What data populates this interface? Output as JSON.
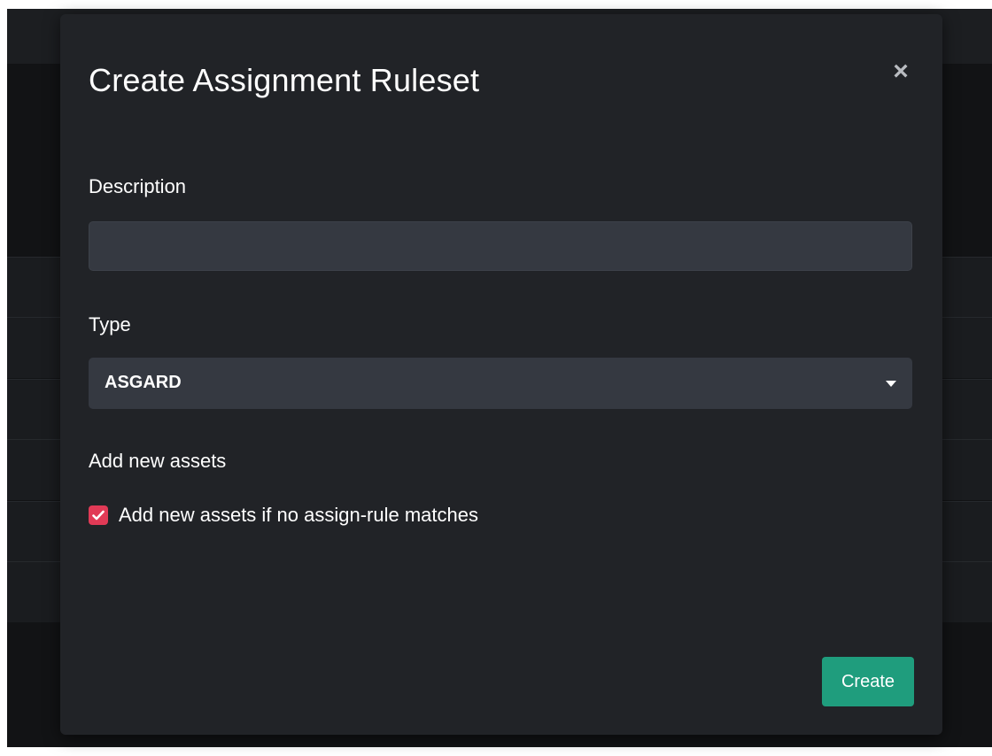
{
  "modal": {
    "title": "Create Assignment Ruleset",
    "close_icon": "close-icon"
  },
  "description": {
    "label": "Description",
    "value": "",
    "placeholder": ""
  },
  "type": {
    "label": "Type",
    "selected": "ASGARD",
    "caret_icon": "caret-down-icon"
  },
  "add_new_assets": {
    "label": "Add new assets",
    "checkbox_label": "Add new assets if no assign-rule matches",
    "checked": true,
    "checkbox_color": "#e13a56"
  },
  "footer": {
    "create_label": "Create",
    "create_color": "#1f9d7d"
  }
}
